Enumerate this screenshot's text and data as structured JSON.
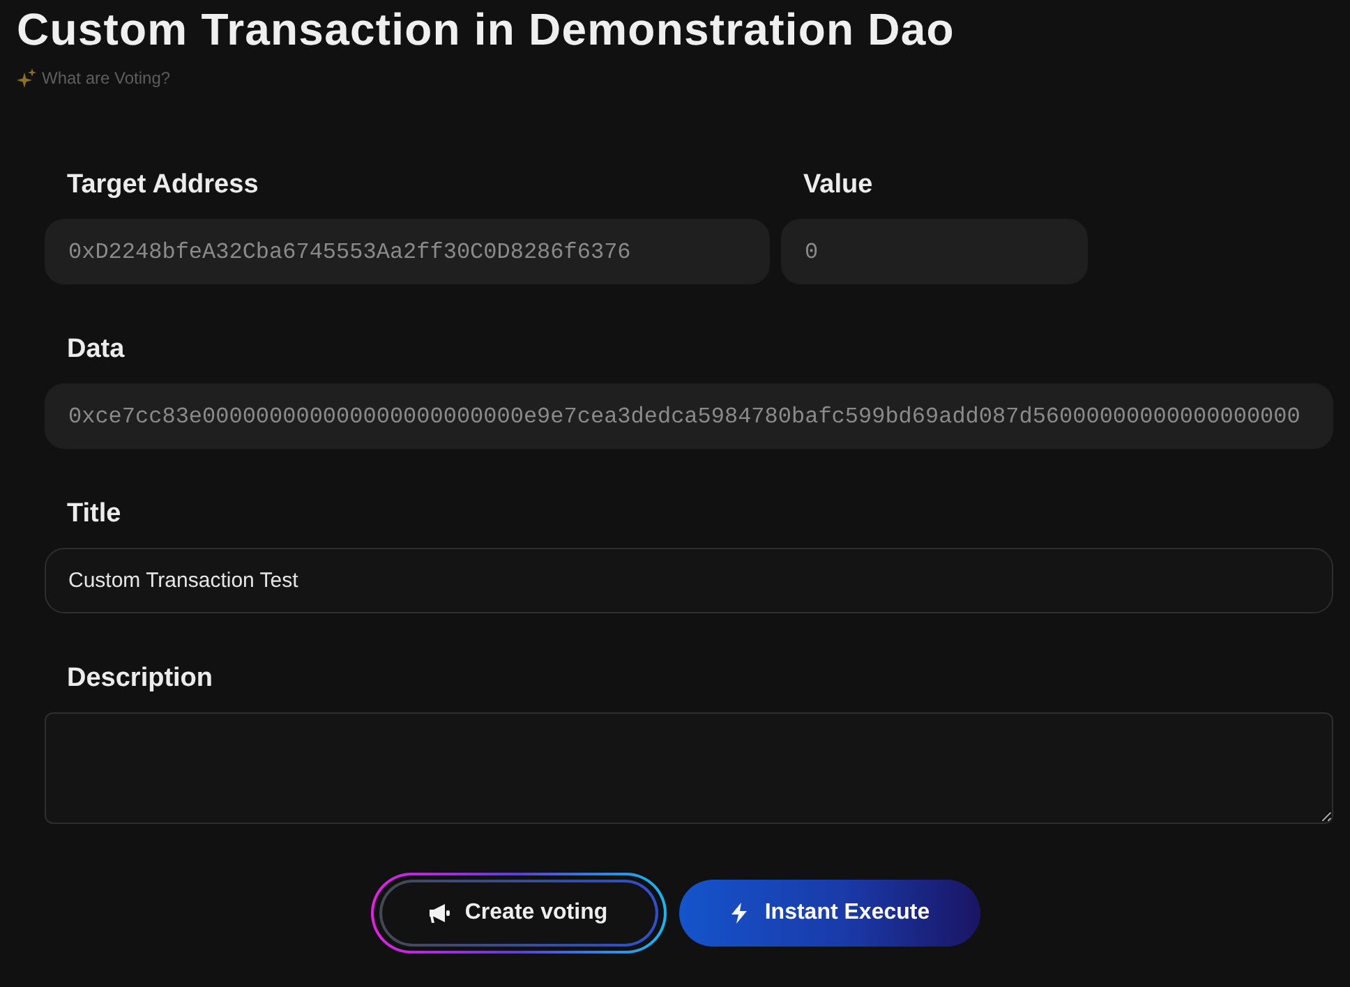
{
  "page": {
    "title": "Custom Transaction in Demonstration Dao",
    "help_link": "What are Voting?"
  },
  "form": {
    "rows": [
      {
        "fields": [
          {
            "kind": "code",
            "label": "Target Address",
            "value": "0xD2248bfeA32Cba6745553Aa2ff30C0D8286f6376",
            "disabled": true
          },
          {
            "kind": "code",
            "label": "Value",
            "value": "0",
            "disabled": true
          }
        ]
      },
      {
        "fields": [
          {
            "kind": "code",
            "label": "Data",
            "value": "0xce7cc83e000000000000000000000000e9e7cea3dedca5984780bafc599bd69add087d56000000000000000000",
            "disabled": true
          }
        ]
      },
      {
        "fields": [
          {
            "kind": "text",
            "label": "Title",
            "value": "Custom Transaction Test",
            "disabled": false
          }
        ]
      },
      {
        "fields": [
          {
            "kind": "textarea",
            "label": "Description",
            "disabled": false
          }
        ]
      }
    ]
  },
  "buttons": [
    {
      "kind": "outline",
      "label": "Create voting"
    },
    {
      "kind": "primary",
      "label": "Instant Execute"
    }
  ]
}
